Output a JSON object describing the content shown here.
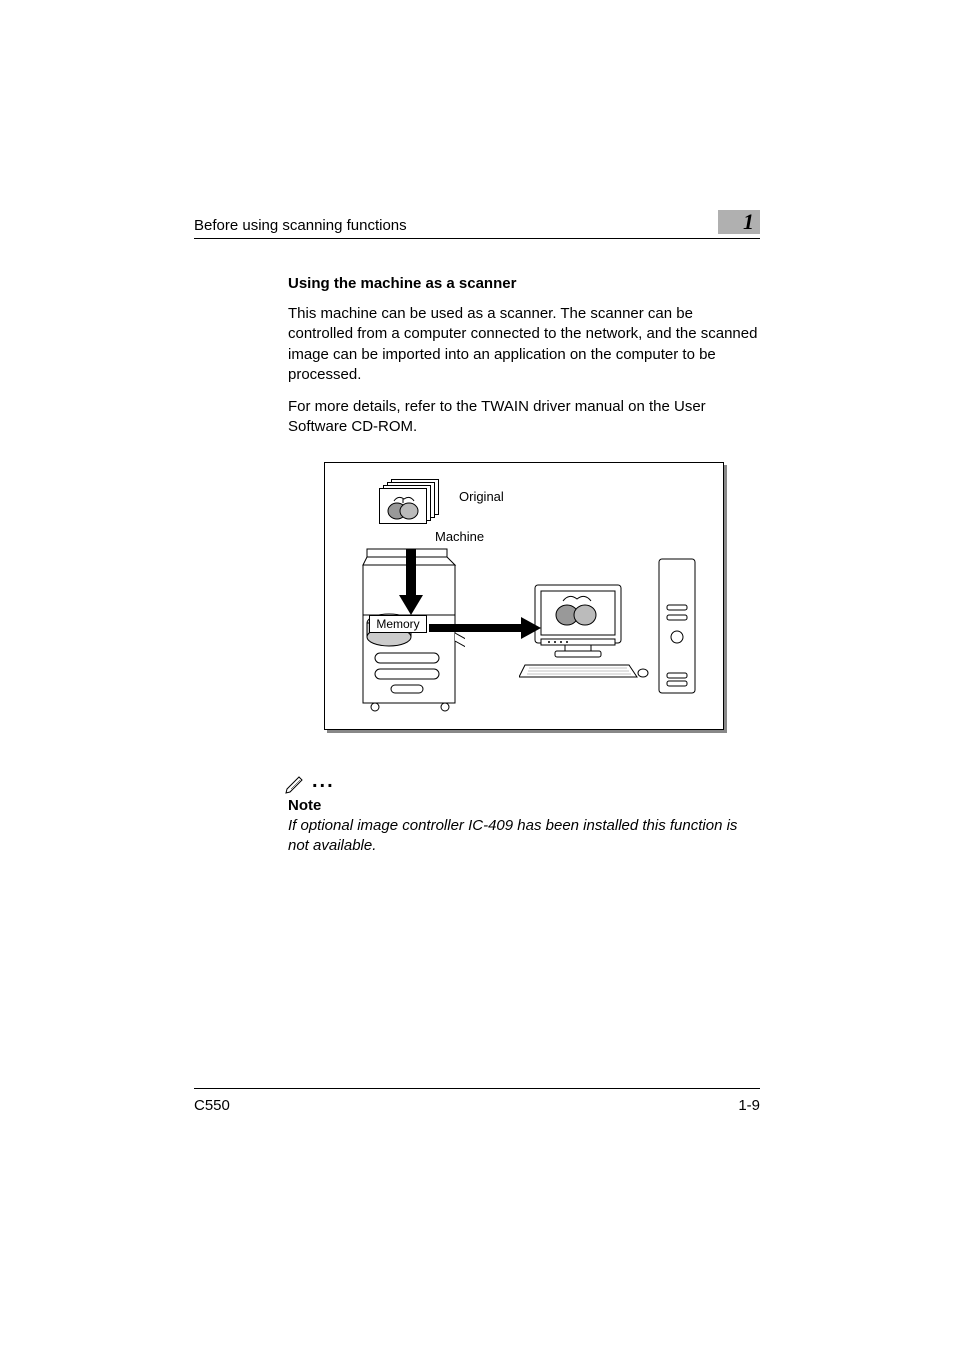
{
  "header": {
    "title": "Before using scanning functions",
    "chapter": "1"
  },
  "section": {
    "title": "Using the machine as a scanner",
    "para1": "This machine can be used as a scanner. The scanner can be controlled from a computer connected to the network, and the scanned image can be imported into an application on the computer to be processed.",
    "para2": "For more details, refer to the TWAIN driver manual on the User Software CD-ROM."
  },
  "diagram": {
    "original": "Original",
    "machine": "Machine",
    "memory": "Memory"
  },
  "note": {
    "label": "Note",
    "text": "If optional image controller IC-409 has been installed this function is not available."
  },
  "footer": {
    "model": "C550",
    "page": "1-9"
  }
}
